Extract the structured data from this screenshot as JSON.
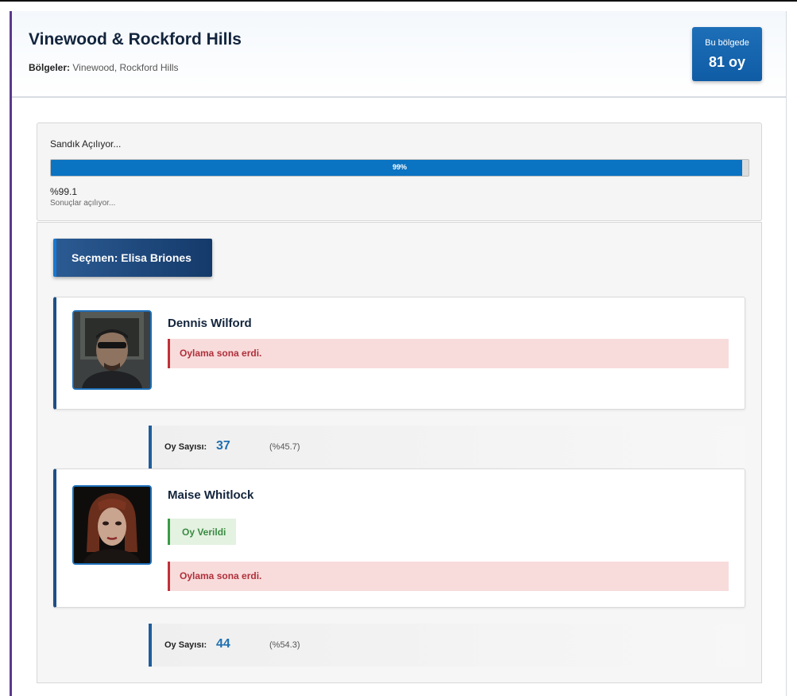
{
  "header": {
    "title": "Vinewood & Rockford Hills",
    "regions_label": "Bölgeler:",
    "regions_value": "Vinewood, Rockford Hills",
    "votes_caption": "Bu bölgede",
    "votes_total": "81 oy"
  },
  "progress": {
    "label": "Sandık Açılıyor...",
    "bar_text": "99%",
    "value_percent": 99.1,
    "percent_text": "%99.1",
    "sub_text": "Sonuçlar açılıyor..."
  },
  "voter": {
    "label": "Seçmen: Elisa Briones"
  },
  "candidates": [
    {
      "name": "Dennis Wilford",
      "ended_text": "Oylama sona erdi.",
      "count_label": "Oy Sayısı:",
      "count": "37",
      "percent": "(%45.7)"
    },
    {
      "name": "Maise Whitlock",
      "voted_text": "Oy Verildi",
      "ended_text": "Oylama sona erdi.",
      "count_label": "Oy Sayısı:",
      "count": "44",
      "percent": "(%54.3)"
    }
  ],
  "colors": {
    "accent": "#0a73c2",
    "voter_badge": "#143a6a",
    "alert_red": "#b0303a",
    "success_green": "#3a8a42"
  }
}
